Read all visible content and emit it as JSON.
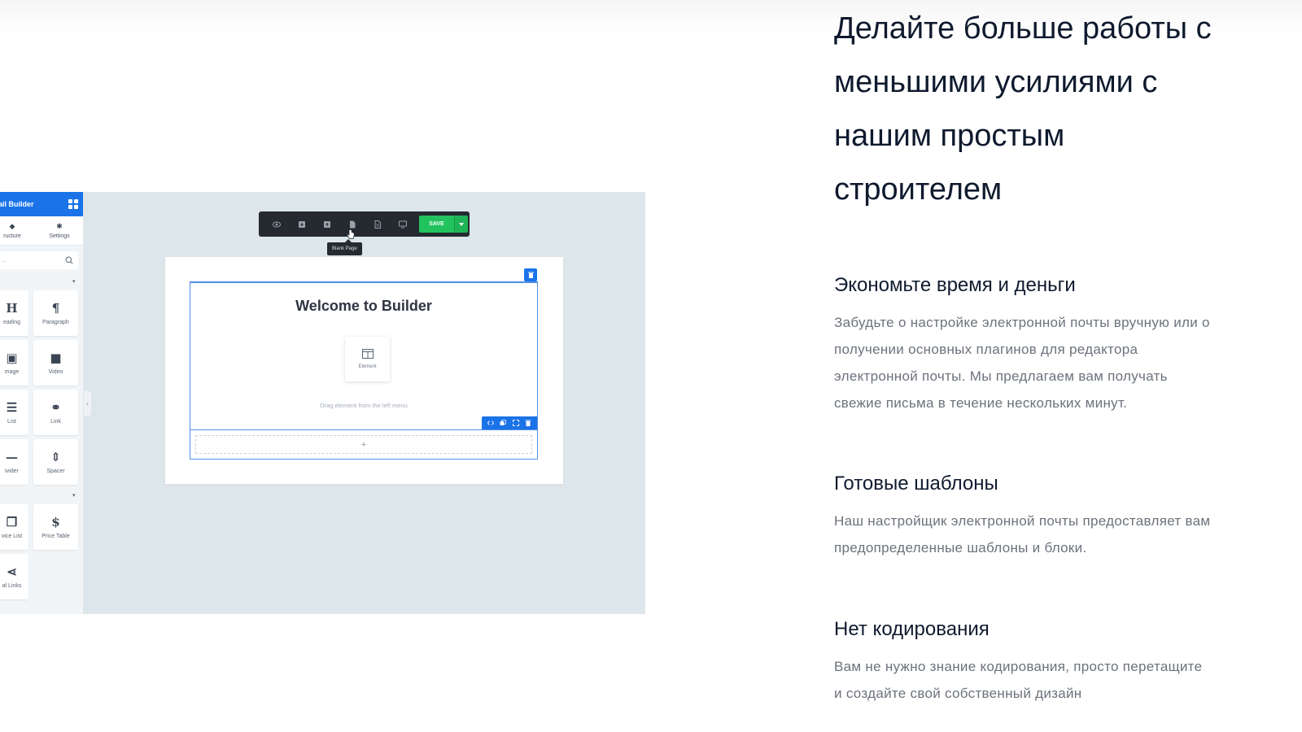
{
  "hero": {
    "line1": "Делайте больше работы с",
    "line2": "меньшими усилиями с",
    "line3": "нашим простым",
    "line4": "строителем"
  },
  "features": [
    {
      "title": "Экономьте время и деньги",
      "lines": [
        "Забудьте о настройке электронной почты вручную или о",
        "получении основных плагинов для редактора",
        "электронной почты. Мы предлагаем вам получать",
        "свежие письма в течение нескольких минут."
      ]
    },
    {
      "title": "Готовые шаблоны",
      "lines": [
        "Наш настройщик электронной почты предоставляет вам",
        "предопределенные шаблоны и блоки."
      ]
    },
    {
      "title": "Нет кодирования",
      "lines": [
        "Вам не нужно знание кодирования, просто перетащите",
        "и создайте свой собственный дизайн"
      ]
    }
  ],
  "builder": {
    "sidebar": {
      "title": "ail Builder",
      "tabs": [
        "ructure",
        "Settings"
      ],
      "search_placeholder": "...",
      "tiles": [
        {
          "glyph": "H",
          "label": "eading"
        },
        {
          "glyph": "¶",
          "label": "Paragraph"
        },
        {
          "glyph": "▣",
          "label": "mage"
        },
        {
          "glyph": "■",
          "label": "Video"
        },
        {
          "glyph": "☰",
          "label": "List"
        },
        {
          "glyph": "⚭",
          "label": "Link"
        },
        {
          "glyph": "—",
          "label": "ivider"
        },
        {
          "glyph": "⇕",
          "label": "Spacer"
        },
        {
          "glyph": "❐",
          "label": "vice List"
        },
        {
          "glyph": "$",
          "label": "Price Table"
        },
        {
          "glyph": "⋖",
          "label": "al Links"
        }
      ]
    },
    "toolbar": {
      "save_label": "SAVE",
      "tooltip": "Blank Page"
    },
    "canvas": {
      "welcome": "Welcome to Builder",
      "element_label": "Element",
      "drag_hint": "Drag element from the left menu",
      "add_symbol": "+"
    },
    "colors": {
      "accent": "#1b73e8",
      "save": "#22c35e",
      "toolbar_bg": "#252a31",
      "mock_bg": "#dde6ea"
    }
  }
}
